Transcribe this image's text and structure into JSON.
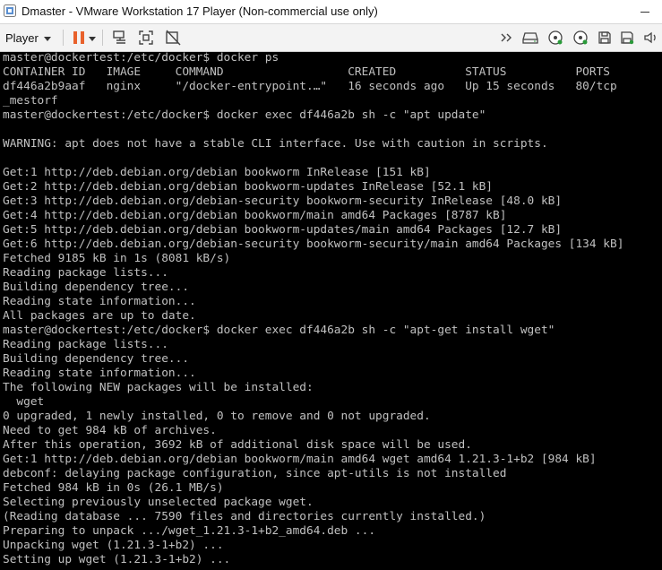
{
  "window": {
    "title": "Dmaster - VMware Workstation 17 Player (Non-commercial use only)",
    "app_icon": "vmware-player-icon"
  },
  "toolbar": {
    "player_label": "Player",
    "left_icons": [
      "pause-icon",
      "send-ctrl-alt-del-icon",
      "fit-guest-icon",
      "unity-icon"
    ],
    "right_icons": [
      "double-chevron-icon",
      "hard-disk-icon",
      "cd-dvd-icon",
      "cd-dvd-2-icon",
      "floppy-icon",
      "speaker-icon"
    ],
    "pause_color": "#e8612c"
  },
  "terminal": {
    "lines": [
      "master@dockertest:/etc/docker$ docker ps",
      "CONTAINER ID   IMAGE     COMMAND                  CREATED          STATUS          PORTS",
      "df446a2b9aaf   nginx     \"/docker-entrypoint.…\"   16 seconds ago   Up 15 seconds   80/tcp",
      "_mestorf",
      "master@dockertest:/etc/docker$ docker exec df446a2b sh -c \"apt update\"",
      "",
      "WARNING: apt does not have a stable CLI interface. Use with caution in scripts.",
      "",
      "Get:1 http://deb.debian.org/debian bookworm InRelease [151 kB]",
      "Get:2 http://deb.debian.org/debian bookworm-updates InRelease [52.1 kB]",
      "Get:3 http://deb.debian.org/debian-security bookworm-security InRelease [48.0 kB]",
      "Get:4 http://deb.debian.org/debian bookworm/main amd64 Packages [8787 kB]",
      "Get:5 http://deb.debian.org/debian bookworm-updates/main amd64 Packages [12.7 kB]",
      "Get:6 http://deb.debian.org/debian-security bookworm-security/main amd64 Packages [134 kB]",
      "Fetched 9185 kB in 1s (8081 kB/s)",
      "Reading package lists...",
      "Building dependency tree...",
      "Reading state information...",
      "All packages are up to date.",
      "master@dockertest:/etc/docker$ docker exec df446a2b sh -c \"apt-get install wget\"",
      "Reading package lists...",
      "Building dependency tree...",
      "Reading state information...",
      "The following NEW packages will be installed:",
      "  wget",
      "0 upgraded, 1 newly installed, 0 to remove and 0 not upgraded.",
      "Need to get 984 kB of archives.",
      "After this operation, 3692 kB of additional disk space will be used.",
      "Get:1 http://deb.debian.org/debian bookworm/main amd64 wget amd64 1.21.3-1+b2 [984 kB]",
      "debconf: delaying package configuration, since apt-utils is not installed",
      "Fetched 984 kB in 0s (26.1 MB/s)",
      "Selecting previously unselected package wget.",
      "(Reading database ... 7590 files and directories currently installed.)",
      "Preparing to unpack .../wget_1.21.3-1+b2_amd64.deb ...",
      "Unpacking wget (1.21.3-1+b2) ...",
      "Setting up wget (1.21.3-1+b2) ..."
    ],
    "colors": {
      "background": "#000000",
      "text": "#c0c0c0"
    }
  }
}
